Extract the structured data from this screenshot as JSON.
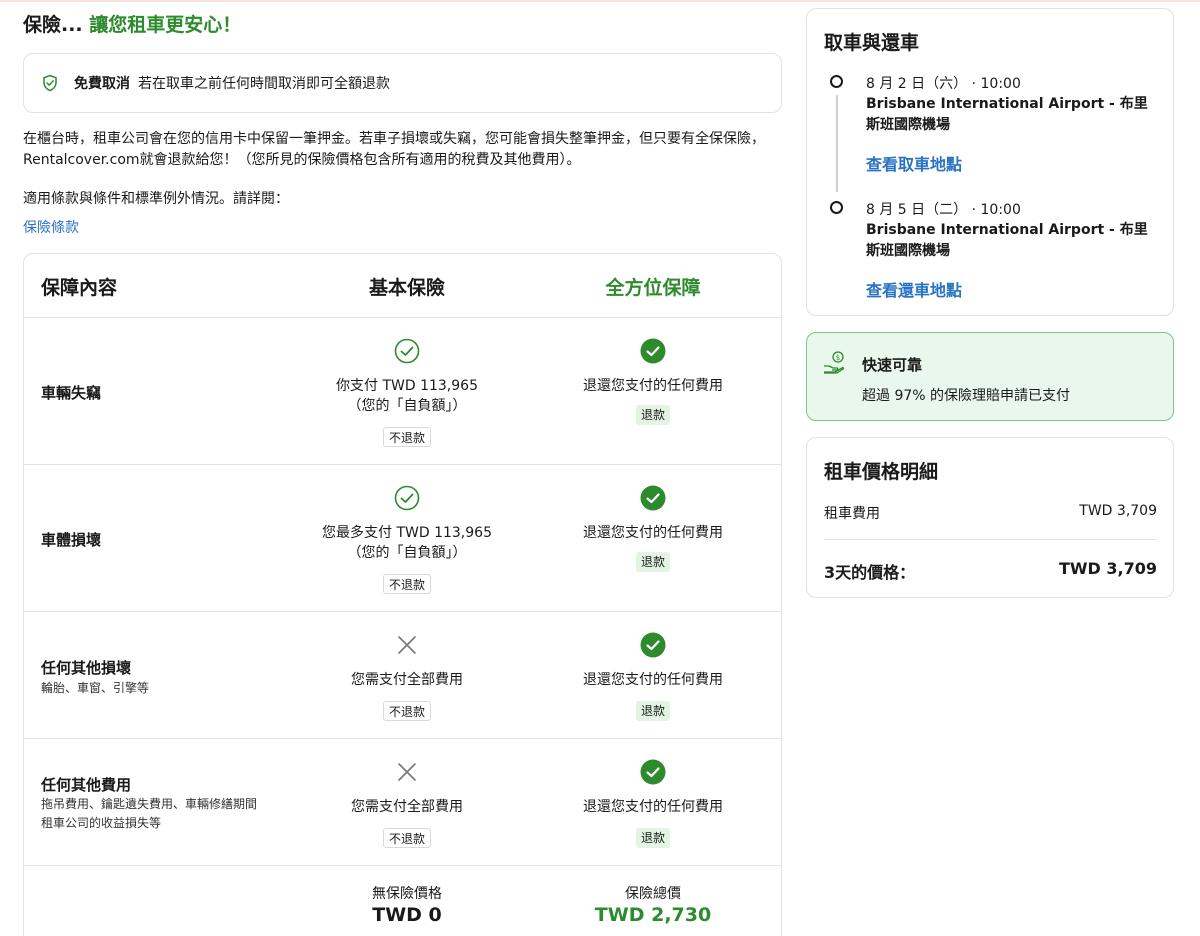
{
  "headline": {
    "part1": "保險... ",
    "part2": "讓您租車更安心！"
  },
  "cancel": {
    "bold": "免費取消",
    "text": "若在取車之前任何時間取消即可全額退款"
  },
  "intro": "在櫃台時，租車公司會在您的信用卡中保留一筆押金。若車子損壞或失竊，您可能會損失整筆押金，但只要有全保保險，Rentalcover.com就會退款給您！（您所見的保險價格包含所有適用的稅費及其他費用）。",
  "terms": {
    "label": "適用條款與條件和標準例外情況。請詳閱：",
    "link": "保險條款"
  },
  "table": {
    "headers": [
      "保障內容",
      "基本保險",
      "全方位保障"
    ],
    "rows": [
      {
        "label": "車輛失竊",
        "sub": "",
        "basic_icon": "check-outline-icon",
        "basic_line1": "你支付 TWD 113,965",
        "basic_line2": "（您的「自負額」）",
        "basic_tag": "不退款",
        "full_icon": "check-filled-icon",
        "full_text": "退還您支付的任何費用",
        "full_tag": "退款"
      },
      {
        "label": "車體損壞",
        "sub": "",
        "basic_icon": "check-outline-icon",
        "basic_line1": "您最多支付 TWD 113,965",
        "basic_line2": "（您的「自負額」）",
        "basic_tag": "不退款",
        "full_icon": "check-filled-icon",
        "full_text": "退還您支付的任何費用",
        "full_tag": "退款"
      },
      {
        "label": "任何其他損壞",
        "sub": "輪胎、車窗、引擎等",
        "basic_icon": "x-icon",
        "basic_line1": "您需支付全部費用",
        "basic_line2": "",
        "basic_tag": "不退款",
        "full_icon": "check-filled-icon",
        "full_text": "退還您支付的任何費用",
        "full_tag": "退款"
      },
      {
        "label": "任何其他費用",
        "sub": "拖吊費用、鑰匙遺失費用、車輛修繕期間\n租車公司的收益損失等",
        "basic_icon": "x-icon",
        "basic_line1": "您需支付全部費用",
        "basic_line2": "",
        "basic_tag": "不退款",
        "full_icon": "check-filled-icon",
        "full_text": "退還您支付的任何費用",
        "full_tag": "退款"
      }
    ],
    "footer": {
      "basic_label": "無保險價格",
      "basic_value": "TWD 0",
      "full_label": "保險總價",
      "full_value": "TWD 2,730"
    }
  },
  "pickup": {
    "title": "取車與還車",
    "pickup_date": "8 月 2 日（六） · 10:00",
    "pickup_place": "Brisbane International Airport - 布里斯班國際機場",
    "pickup_link": "查看取車地點",
    "return_date": "8 月 5 日（二） · 10:00",
    "return_place": "Brisbane International Airport - 布里斯班國際機場",
    "return_link": "查看還車地點"
  },
  "fast": {
    "title": "快速可靠",
    "text": "超過 97% 的保險理賠申請已支付"
  },
  "price": {
    "title": "租車價格明細",
    "fee_label": "租車費用",
    "fee_value": "TWD 3,709",
    "total_label": "3天的價格：",
    "total_value": "TWD 3,709"
  },
  "colors": {
    "green": "#2d8a2d",
    "link": "#2a73c4",
    "fast_bg": "#eaf7ec",
    "tag_green_bg": "#e3f4e3"
  }
}
